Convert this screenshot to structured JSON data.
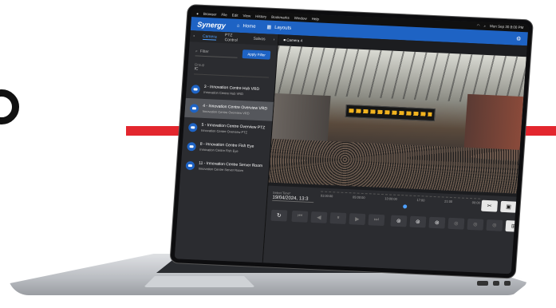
{
  "menubar": {
    "items": [
      "Browser",
      "File",
      "Edit",
      "View",
      "History",
      "Bookmarks",
      "Window",
      "Help"
    ],
    "clock": "Mon Sep 30  8:00 PM"
  },
  "appbar": {
    "brand": "Synergy",
    "nav_home": "Home",
    "nav_layouts": "Layouts"
  },
  "sidebar": {
    "tabs": [
      "Camera",
      "PTZ Control",
      "Salvos"
    ],
    "filter_placeholder": "Filter",
    "apply_filter": "Apply Filter",
    "group_label": "Group",
    "group_value": "IC",
    "cameras": [
      {
        "title": "3 - Innovation Centre Hub VRD",
        "subtitle": "Innovation Centre Hub VRD",
        "selected": false
      },
      {
        "title": "4 - Innovation Centre Overview VRD",
        "subtitle": "Innovation Centre Overview VRD",
        "selected": true
      },
      {
        "title": "5 - Innovation Centre Overview PTZ",
        "subtitle": "Innovation Centre Overview PTZ",
        "selected": false
      },
      {
        "title": "8 - Innovation Centre Fish Eye",
        "subtitle": "Innovation Centre Fish Eye",
        "selected": false
      },
      {
        "title": "11 - Innovation Centre Server Room",
        "subtitle": "Innovation Centre Server Room",
        "selected": false
      }
    ]
  },
  "main": {
    "camera_label": "Camera 4",
    "select_time_label": "Select Time*",
    "select_time_value": "19/04/2024, 13:3",
    "timeline_ticks": [
      "01:00:00",
      "05:00:00",
      "13:00:00",
      "17:00",
      "21:00",
      "00:00"
    ]
  },
  "colors": {
    "accent": "#1e63c4",
    "red_line": "#e3262e"
  }
}
